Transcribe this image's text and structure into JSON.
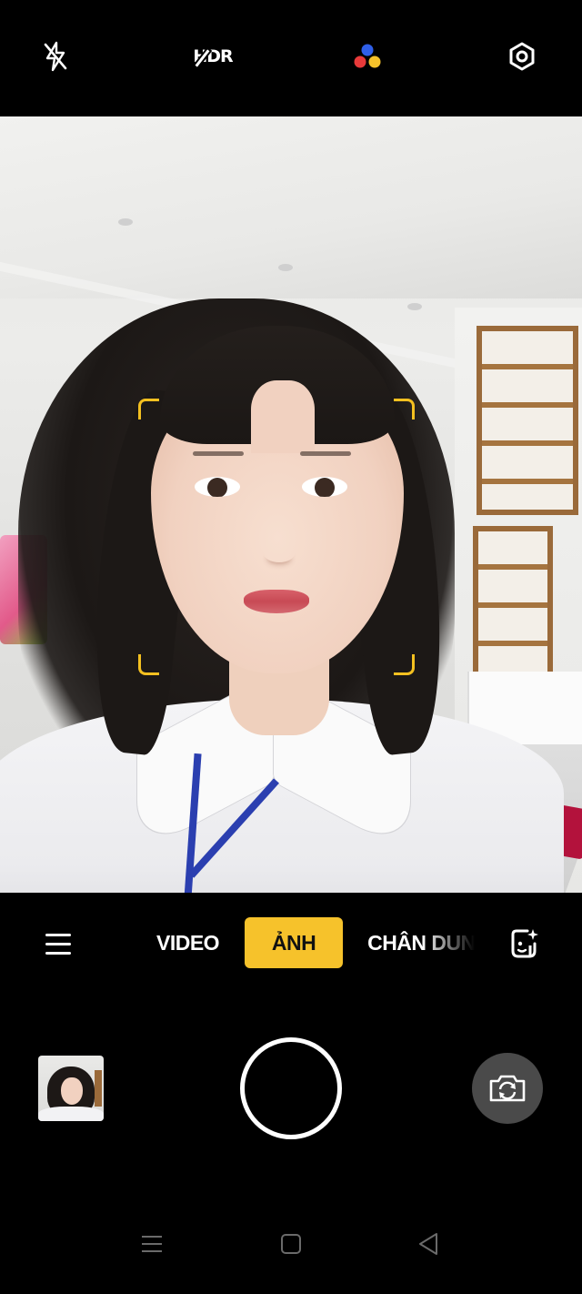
{
  "top_bar": {
    "icons": [
      "flash-off-icon",
      "hdr-off-icon",
      "color-filter-icon",
      "settings-icon"
    ],
    "hdr_label": "HDR"
  },
  "viewfinder": {
    "focus_color": "#f4c020"
  },
  "mode_bar": {
    "modes": [
      {
        "label": "VIDEO",
        "active": false
      },
      {
        "label": "ẢNH",
        "active": true
      },
      {
        "label": "CHÂN DUNG",
        "active": false
      }
    ],
    "active_color": "#f6c22b",
    "menu_icon": "hamburger-menu-icon",
    "beauty_icon": "beauty-face-icon"
  },
  "controls": {
    "gallery_thumbnail": "last-photo-thumbnail",
    "shutter": "shutter-button",
    "switch_camera_icon": "switch-camera-icon"
  },
  "nav_bar": {
    "icons": [
      "recent-apps-icon",
      "home-icon",
      "back-icon"
    ]
  }
}
